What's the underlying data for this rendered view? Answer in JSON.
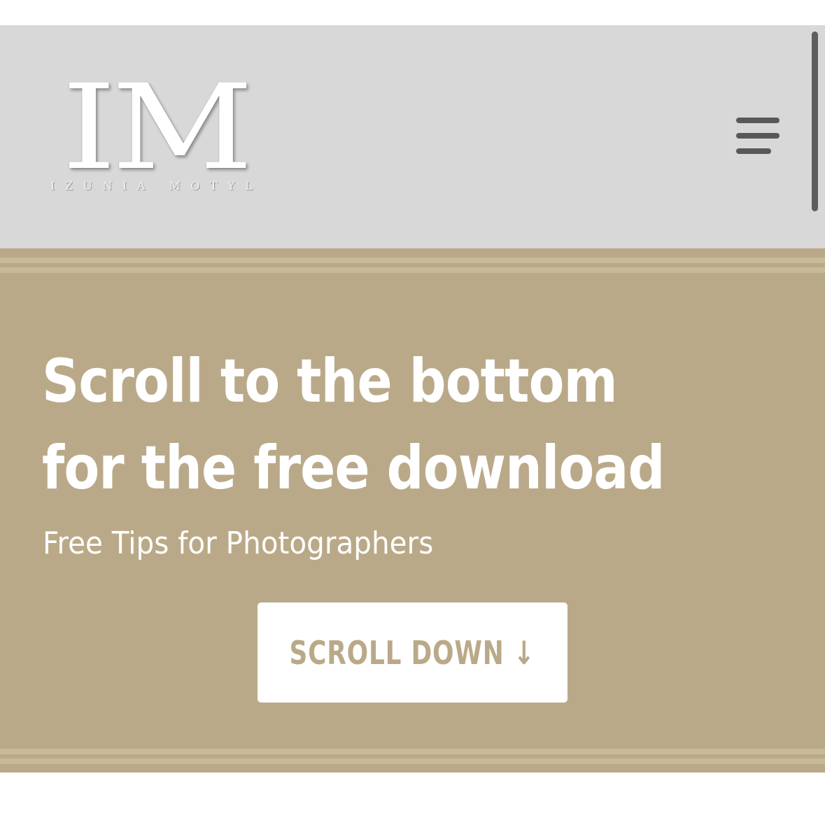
{
  "header": {
    "logo": {
      "mark": "IM",
      "name": "IZUNIA MOTYL"
    },
    "menu_icon": "hamburger-menu-icon"
  },
  "hero": {
    "title": "Scroll to the bottom for the free download",
    "subtitle": "Free Tips for Photographers",
    "cta_label": "SCROLL DOWN ↓"
  },
  "colors": {
    "header_bg": "#d8d8d8",
    "hero_bg": "#baa988",
    "accent": "#baa988",
    "menu_icon": "#585858",
    "button_bg": "#ffffff"
  }
}
